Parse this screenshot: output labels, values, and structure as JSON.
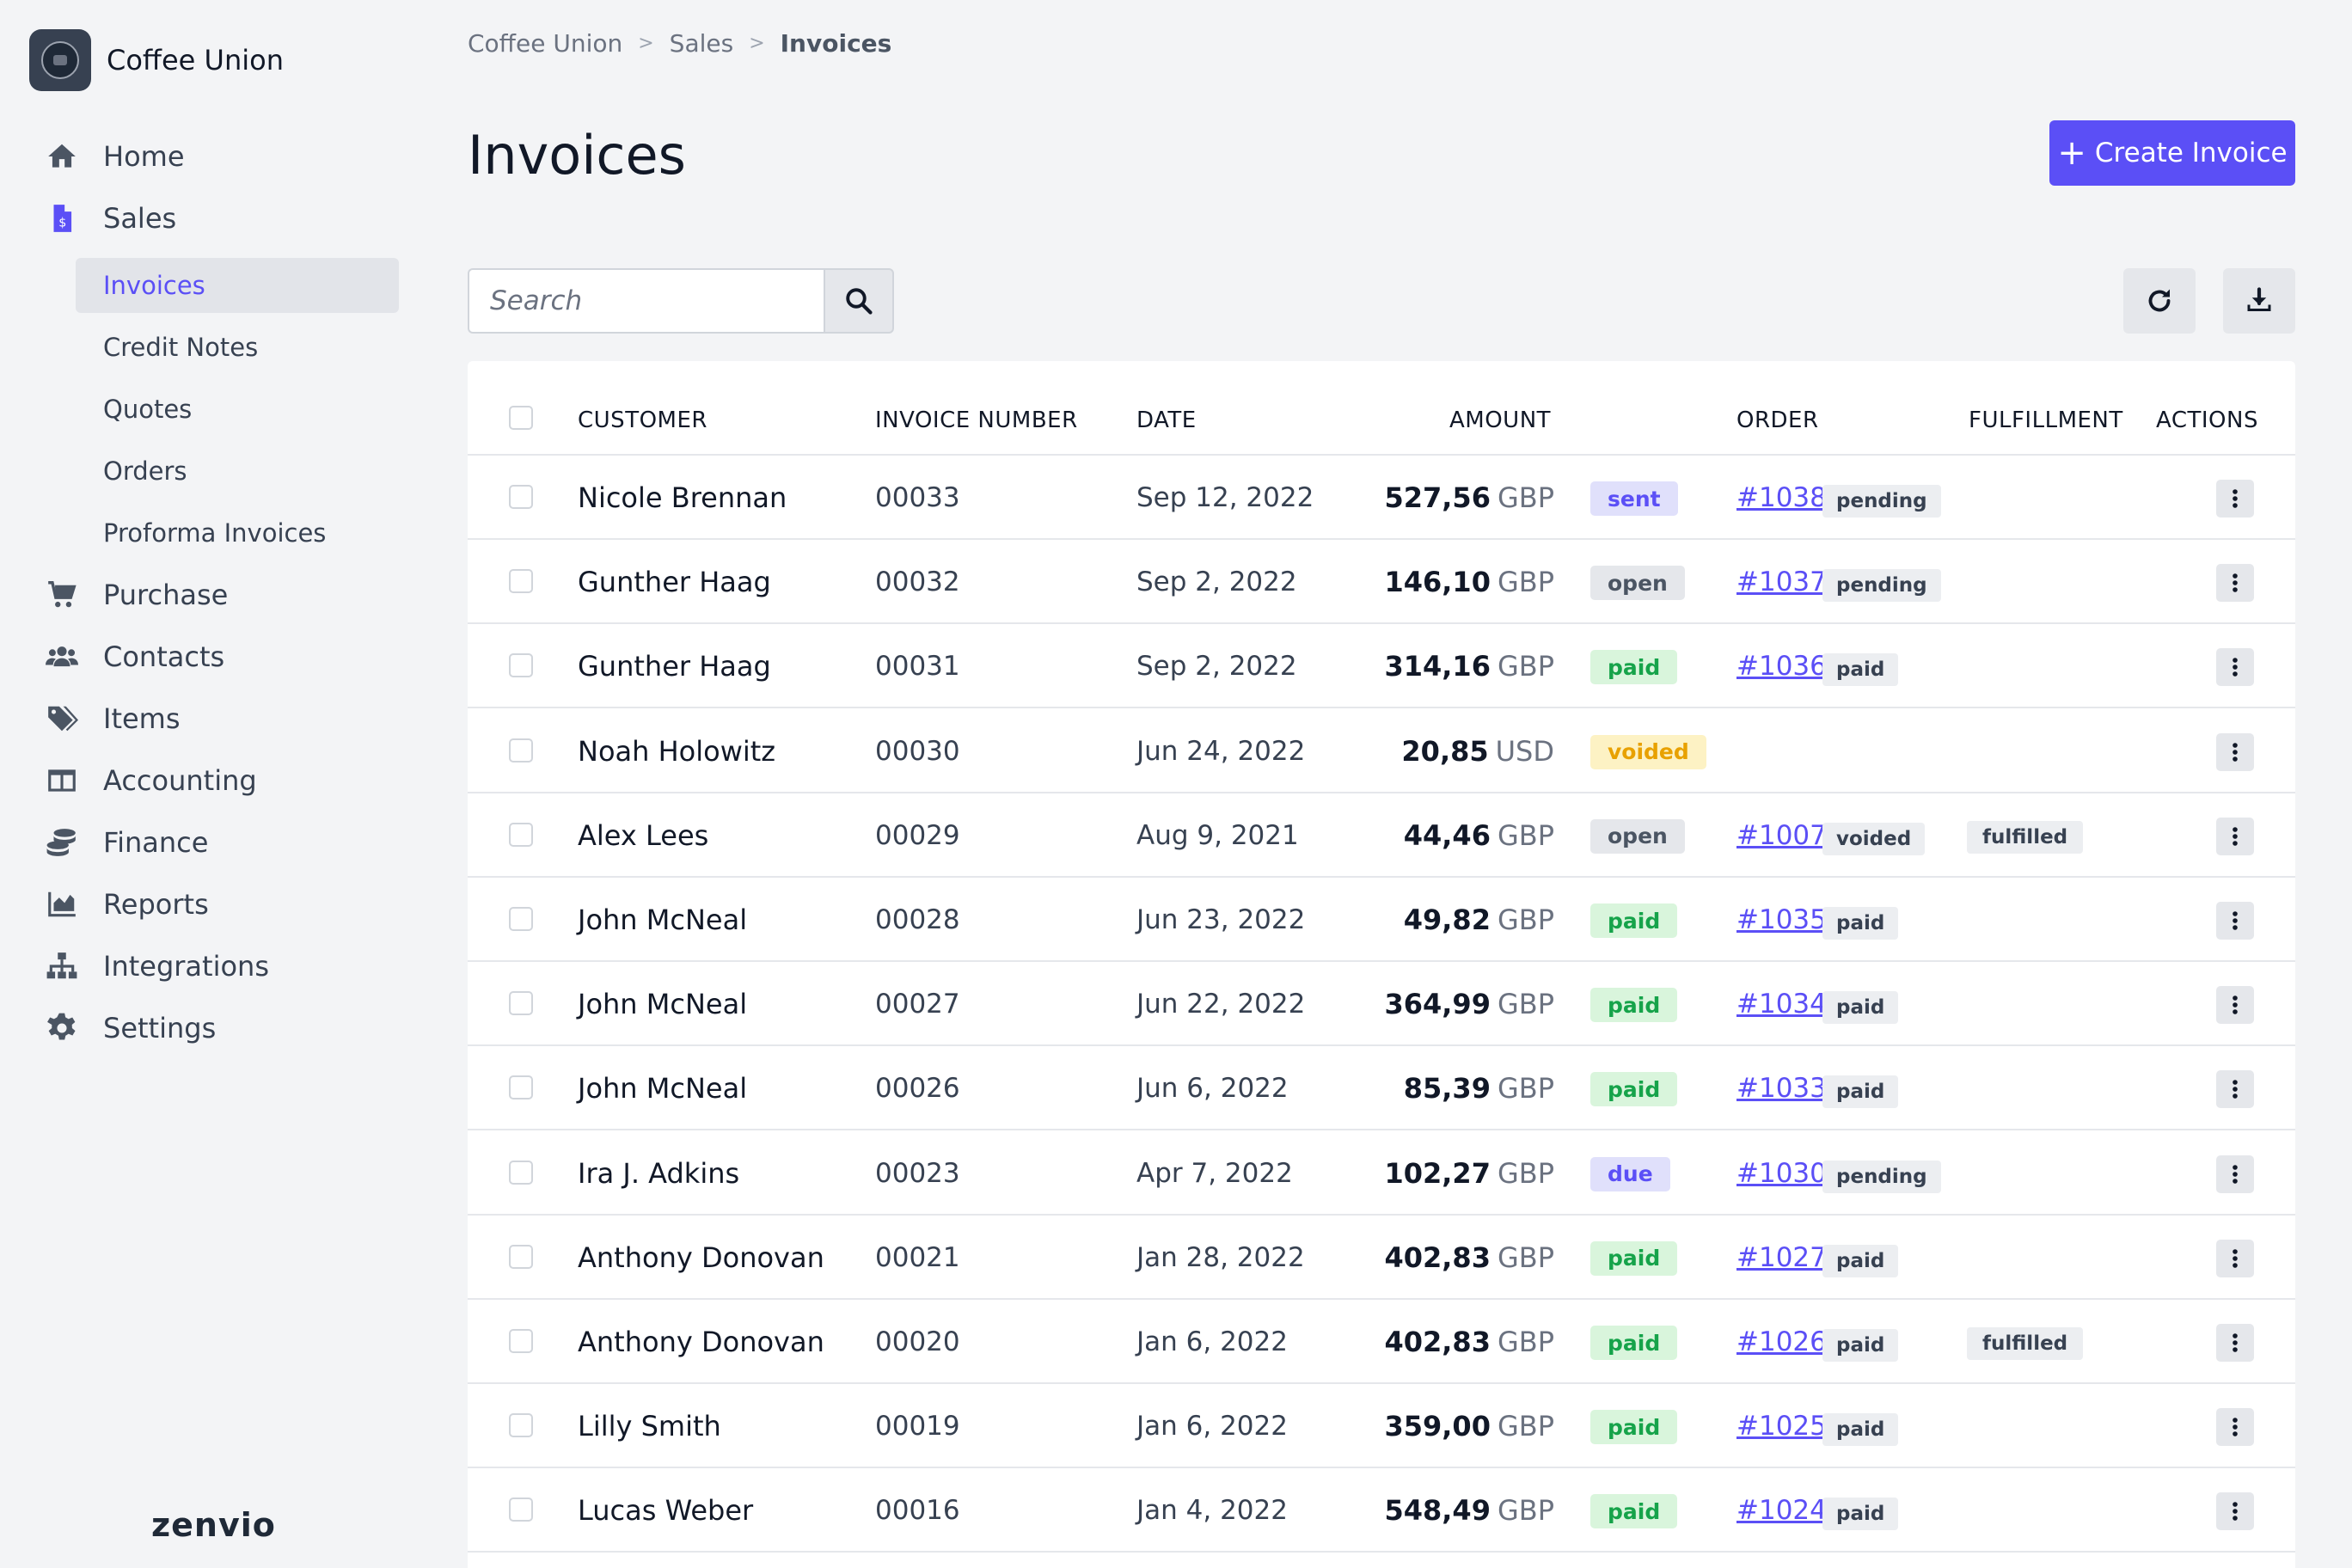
{
  "brand": {
    "name": "Coffee Union"
  },
  "nav": {
    "items": [
      {
        "key": "home",
        "label": "Home",
        "icon": "home-icon"
      },
      {
        "key": "sales",
        "label": "Sales",
        "icon": "invoice-dollar-icon"
      },
      {
        "key": "purchase",
        "label": "Purchase",
        "icon": "cart-icon"
      },
      {
        "key": "contacts",
        "label": "Contacts",
        "icon": "users-icon"
      },
      {
        "key": "items",
        "label": "Items",
        "icon": "tags-icon"
      },
      {
        "key": "accounting",
        "label": "Accounting",
        "icon": "columns-icon"
      },
      {
        "key": "finance",
        "label": "Finance",
        "icon": "coins-icon"
      },
      {
        "key": "reports",
        "label": "Reports",
        "icon": "area-chart-icon"
      },
      {
        "key": "integrations",
        "label": "Integrations",
        "icon": "sitemap-icon"
      },
      {
        "key": "settings",
        "label": "Settings",
        "icon": "gear-icon"
      }
    ],
    "sales_sub": [
      {
        "label": "Invoices",
        "active": true
      },
      {
        "label": "Credit Notes",
        "active": false
      },
      {
        "label": "Quotes",
        "active": false
      },
      {
        "label": "Orders",
        "active": false
      },
      {
        "label": "Proforma Invoices",
        "active": false
      }
    ]
  },
  "footer": {
    "logo": "zenvio"
  },
  "breadcrumb": {
    "items": [
      "Coffee Union",
      "Sales",
      "Invoices"
    ],
    "separator": ">"
  },
  "page": {
    "title": "Invoices",
    "create_label": "Create Invoice"
  },
  "search": {
    "placeholder": "Search",
    "value": ""
  },
  "table": {
    "headers": {
      "customer": "CUSTOMER",
      "invoice_number": "INVOICE NUMBER",
      "date": "DATE",
      "amount": "AMOUNT",
      "order": "ORDER",
      "fulfillment": "FULFILLMENT",
      "actions": "ACTIONS"
    },
    "rows": [
      {
        "customer": "Nicole Brennan",
        "number": "00033",
        "date": "Sep 12, 2022",
        "amount": "527,56",
        "currency": "GBP",
        "status": "sent",
        "order": "#1038",
        "order_status": "pending",
        "fulfillment": ""
      },
      {
        "customer": "Gunther Haag",
        "number": "00032",
        "date": "Sep 2, 2022",
        "amount": "146,10",
        "currency": "GBP",
        "status": "open",
        "order": "#1037",
        "order_status": "pending",
        "fulfillment": ""
      },
      {
        "customer": "Gunther Haag",
        "number": "00031",
        "date": "Sep 2, 2022",
        "amount": "314,16",
        "currency": "GBP",
        "status": "paid",
        "order": "#1036",
        "order_status": "paid",
        "fulfillment": ""
      },
      {
        "customer": "Noah Holowitz",
        "number": "00030",
        "date": "Jun 24, 2022",
        "amount": "20,85",
        "currency": "USD",
        "status": "voided",
        "order": "",
        "order_status": "",
        "fulfillment": ""
      },
      {
        "customer": "Alex Lees",
        "number": "00029",
        "date": "Aug 9, 2021",
        "amount": "44,46",
        "currency": "GBP",
        "status": "open",
        "order": "#1007",
        "order_status": "voided",
        "fulfillment": "fulfilled"
      },
      {
        "customer": "John McNeal",
        "number": "00028",
        "date": "Jun 23, 2022",
        "amount": "49,82",
        "currency": "GBP",
        "status": "paid",
        "order": "#1035",
        "order_status": "paid",
        "fulfillment": ""
      },
      {
        "customer": "John McNeal",
        "number": "00027",
        "date": "Jun 22, 2022",
        "amount": "364,99",
        "currency": "GBP",
        "status": "paid",
        "order": "#1034",
        "order_status": "paid",
        "fulfillment": ""
      },
      {
        "customer": "John McNeal",
        "number": "00026",
        "date": "Jun 6, 2022",
        "amount": "85,39",
        "currency": "GBP",
        "status": "paid",
        "order": "#1033",
        "order_status": "paid",
        "fulfillment": ""
      },
      {
        "customer": "Ira J. Adkins",
        "number": "00023",
        "date": "Apr 7, 2022",
        "amount": "102,27",
        "currency": "GBP",
        "status": "due",
        "order": "#1030",
        "order_status": "pending",
        "fulfillment": ""
      },
      {
        "customer": "Anthony Donovan",
        "number": "00021",
        "date": "Jan 28, 2022",
        "amount": "402,83",
        "currency": "GBP",
        "status": "paid",
        "order": "#1027",
        "order_status": "paid",
        "fulfillment": ""
      },
      {
        "customer": "Anthony Donovan",
        "number": "00020",
        "date": "Jan 6, 2022",
        "amount": "402,83",
        "currency": "GBP",
        "status": "paid",
        "order": "#1026",
        "order_status": "paid",
        "fulfillment": "fulfilled"
      },
      {
        "customer": "Lilly Smith",
        "number": "00019",
        "date": "Jan 6, 2022",
        "amount": "359,00",
        "currency": "GBP",
        "status": "paid",
        "order": "#1025",
        "order_status": "paid",
        "fulfillment": ""
      },
      {
        "customer": "Lucas Weber",
        "number": "00016",
        "date": "Jan 4, 2022",
        "amount": "548,49",
        "currency": "GBP",
        "status": "paid",
        "order": "#1024",
        "order_status": "paid",
        "fulfillment": ""
      }
    ]
  },
  "colors": {
    "accent": "#5b4ff6",
    "paid": "#16a34a",
    "voided": "#e8a100"
  }
}
